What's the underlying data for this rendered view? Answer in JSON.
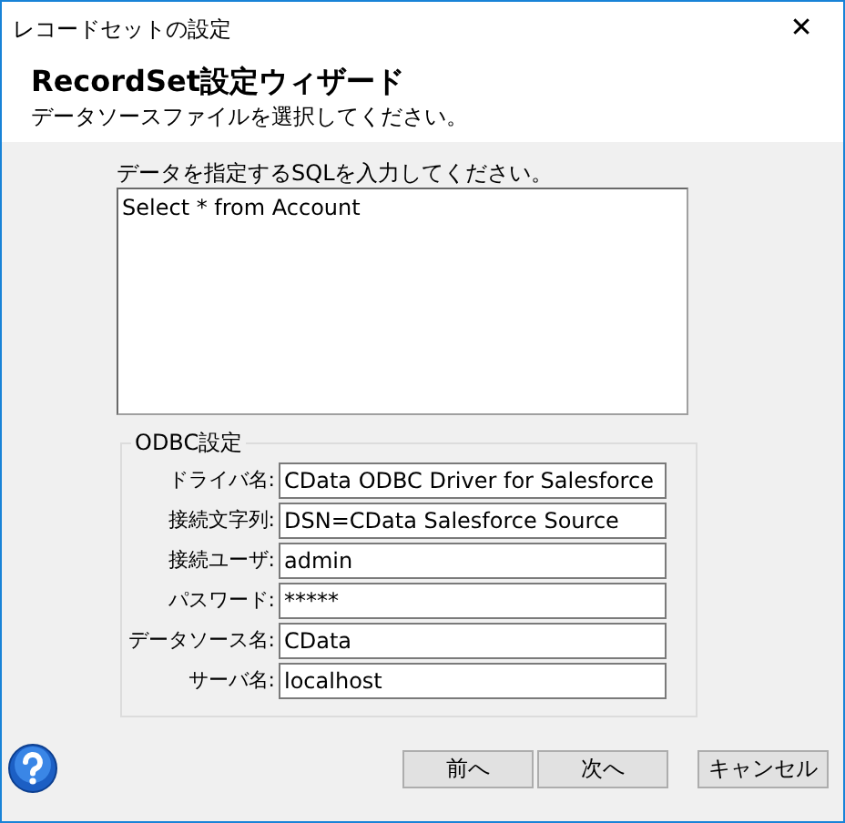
{
  "window": {
    "title": "レコードセットの設定",
    "close": "✕"
  },
  "header": {
    "title": "RecordSet設定ウィザード",
    "subtitle": "データソースファイルを選択してください。"
  },
  "sql": {
    "label": "データを指定するSQLを入力してください。",
    "value": "Select * from Account"
  },
  "odbc": {
    "title": "ODBC設定",
    "fields": [
      {
        "label": "ドライバ名:",
        "value": "CData ODBC Driver for Salesforce"
      },
      {
        "label": "接続文字列:",
        "value": "DSN=CData Salesforce Source"
      },
      {
        "label": "接続ユーザ:",
        "value": "admin"
      },
      {
        "label": "パスワード:",
        "value": "*****"
      },
      {
        "label": "データソース名:",
        "value": "CData"
      },
      {
        "label": "サーバ名:",
        "value": "localhost"
      }
    ]
  },
  "buttons": [
    {
      "label": "前へ"
    },
    {
      "label": "次へ"
    },
    {
      "label": "キャンセル"
    }
  ]
}
